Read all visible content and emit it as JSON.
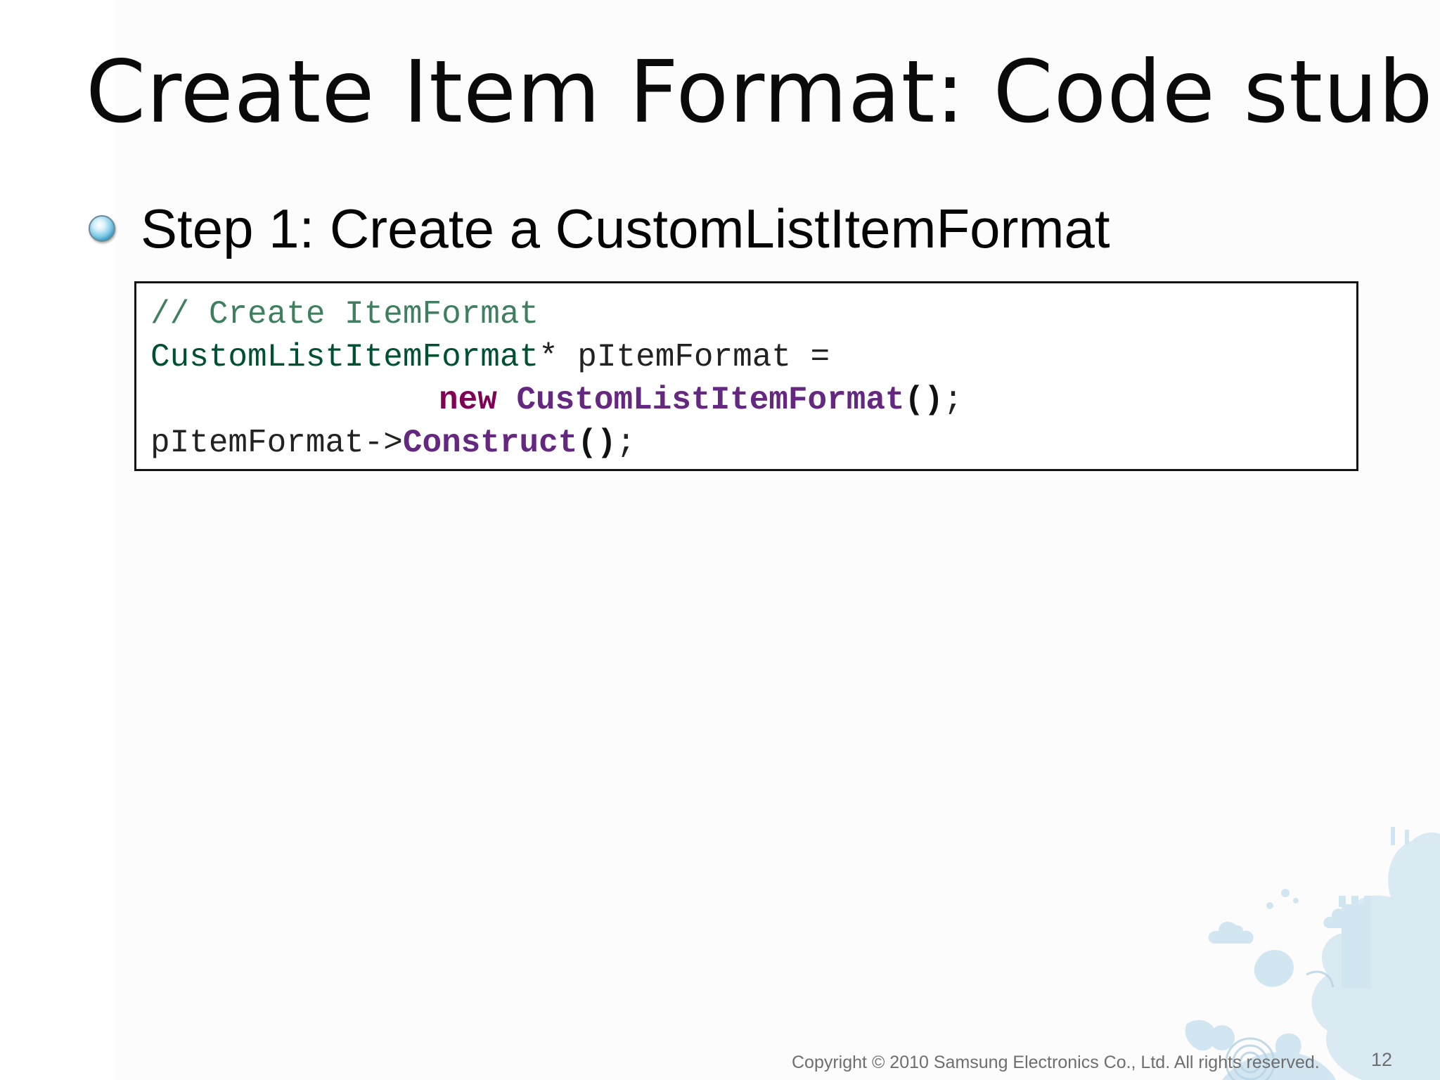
{
  "slide": {
    "title": "Create Item Format: Code stub",
    "bullet": {
      "text": "Step 1: Create a CustomListItemFormat",
      "icon": "bullet-circle-icon"
    },
    "code": {
      "line1_comment": "// Create ItemFormat",
      "line2_type": "CustomListItemFormat",
      "line2_rest": "* pItemFormat =",
      "line3_keyword": "new",
      "line3_class": "CustomListItemFormat",
      "line3_parens": "()",
      "line3_semicolon": ";",
      "line4_object": "pItemFormat->",
      "line4_method": "Construct",
      "line4_parens": "()",
      "line4_semicolon": ";"
    },
    "footer": {
      "copyright": "Copyright © 2010 Samsung Electronics Co., Ltd. All rights reserved.",
      "page_number": "12"
    },
    "decoration": {
      "icon": "samsung-illustration-icon",
      "color": "#cfe3ef"
    }
  }
}
